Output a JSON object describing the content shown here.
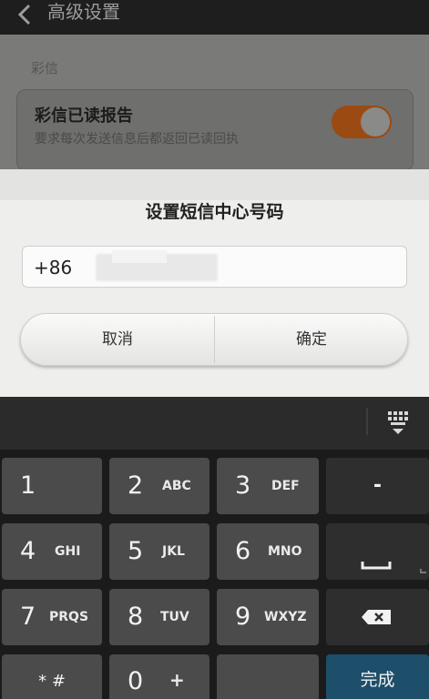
{
  "header": {
    "title": "高级设置"
  },
  "settings": {
    "section_label": "彩信",
    "read_report": {
      "title": "彩信已读报告",
      "subtitle": "要求每次发送信息后都返回已读回执",
      "enabled": true
    }
  },
  "dialog": {
    "title": "设置短信中心号码",
    "input_value": "+86",
    "cancel_label": "取消",
    "ok_label": "确定"
  },
  "keyboard": {
    "keys": [
      {
        "num": "1",
        "letters": ""
      },
      {
        "num": "2",
        "letters": "ABC"
      },
      {
        "num": "3",
        "letters": "DEF"
      },
      {
        "num": "4",
        "letters": "GHI"
      },
      {
        "num": "5",
        "letters": "JKL"
      },
      {
        "num": "6",
        "letters": "MNO"
      },
      {
        "num": "7",
        "letters": "PRQS"
      },
      {
        "num": "8",
        "letters": "TUV"
      },
      {
        "num": "9",
        "letters": "WXYZ"
      },
      {
        "num": "0",
        "letters": "+"
      }
    ],
    "star_hash": "* #",
    "dash": "-",
    "done": "完成"
  }
}
